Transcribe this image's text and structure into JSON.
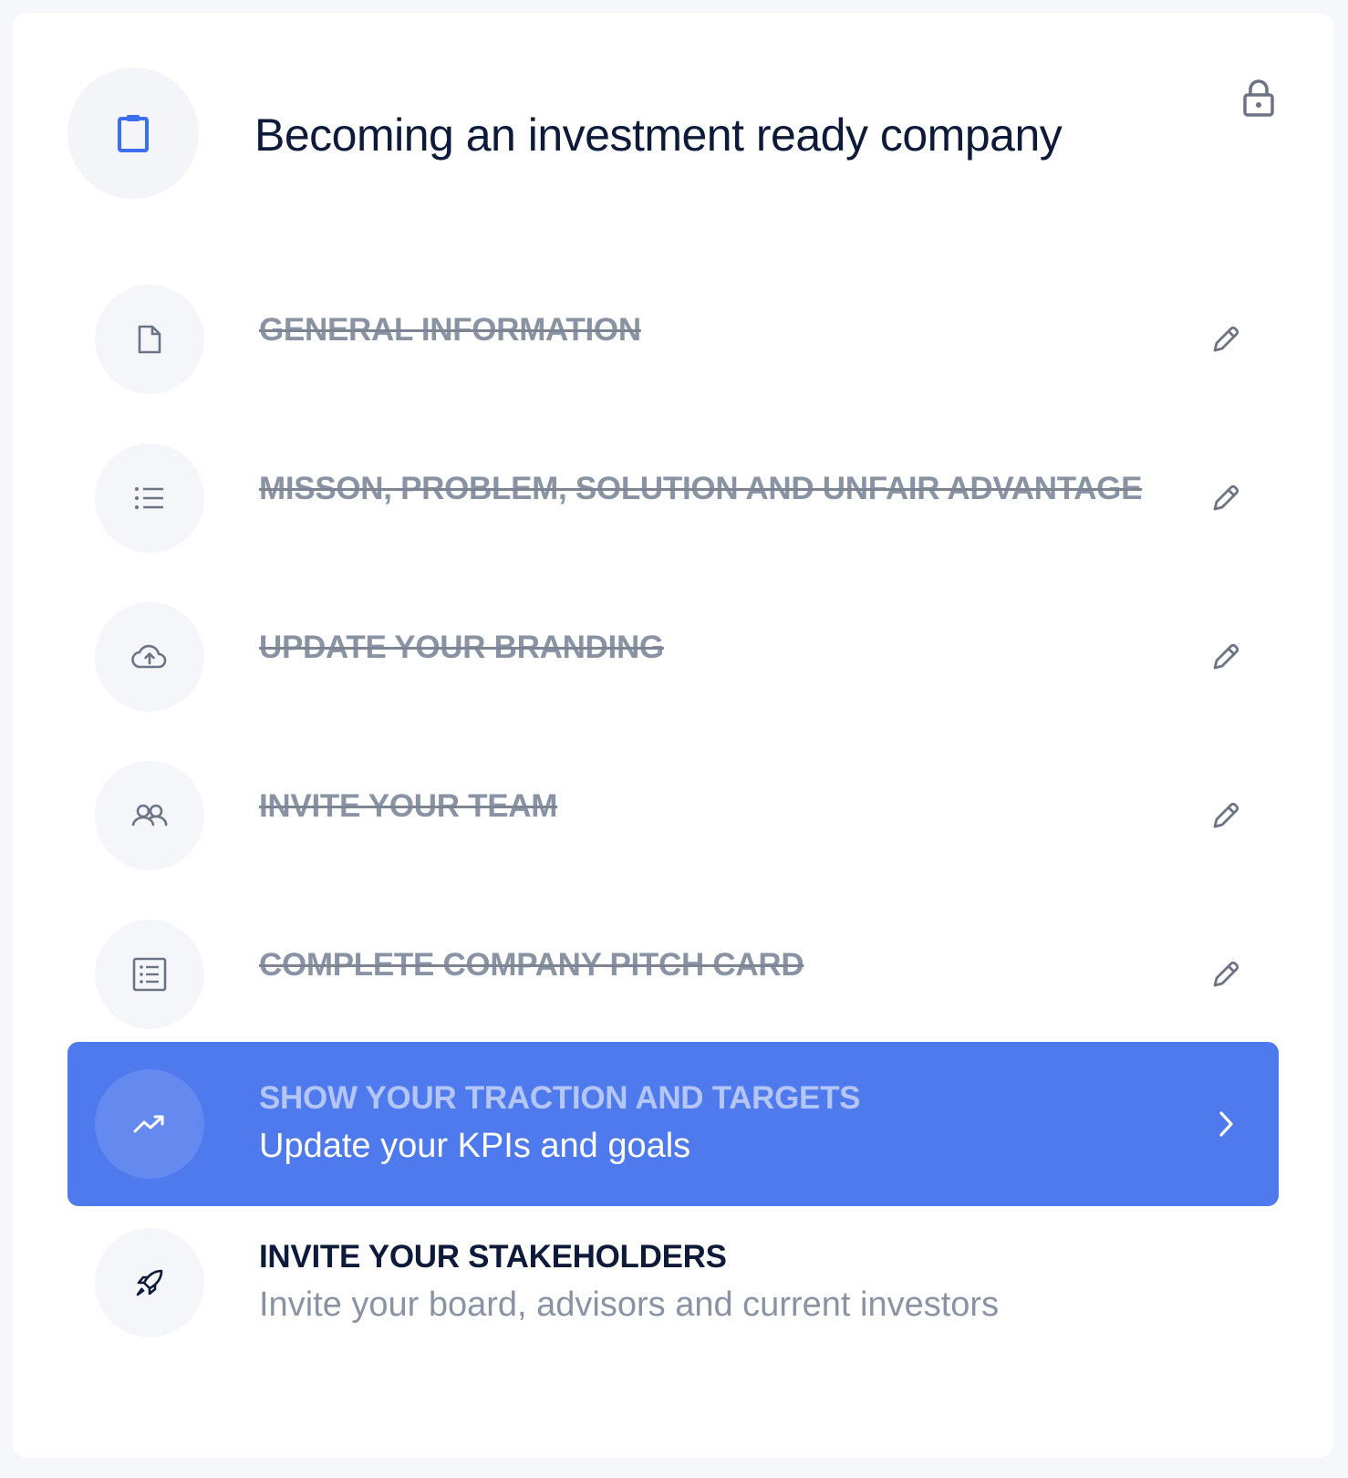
{
  "card": {
    "title": "Becoming an investment ready company",
    "header_icon": "clipboard-icon",
    "status_icon": "lock-icon"
  },
  "steps": [
    {
      "title": "GENERAL INFORMATION",
      "icon": "document-icon",
      "status": "completed",
      "action_icon": "pencil-icon"
    },
    {
      "title": "MISSON, PROBLEM, SOLUTION AND UNFAIR ADVANTAGE",
      "icon": "list-icon",
      "status": "completed",
      "action_icon": "pencil-icon"
    },
    {
      "title": "UPDATE YOUR BRANDING",
      "icon": "cloud-upload-icon",
      "status": "completed",
      "action_icon": "pencil-icon"
    },
    {
      "title": "INVITE YOUR TEAM",
      "icon": "users-icon",
      "status": "completed",
      "action_icon": "pencil-icon"
    },
    {
      "title": "COMPLETE COMPANY PITCH CARD",
      "icon": "checklist-icon",
      "status": "completed",
      "action_icon": "pencil-icon"
    },
    {
      "title": "SHOW YOUR TRACTION AND TARGETS",
      "subtitle": "Update your KPIs and goals",
      "icon": "trending-up-icon",
      "status": "active",
      "action_icon": "chevron-right-icon"
    },
    {
      "title": "INVITE YOUR STAKEHOLDERS",
      "subtitle": "Invite your board, advisors and current investors",
      "icon": "rocket-icon",
      "status": "pending"
    }
  ],
  "colors": {
    "accent": "#4f7aee",
    "heading": "#0d1a3a",
    "muted": "#8a93a3",
    "icon_bg": "#f4f6fa"
  }
}
